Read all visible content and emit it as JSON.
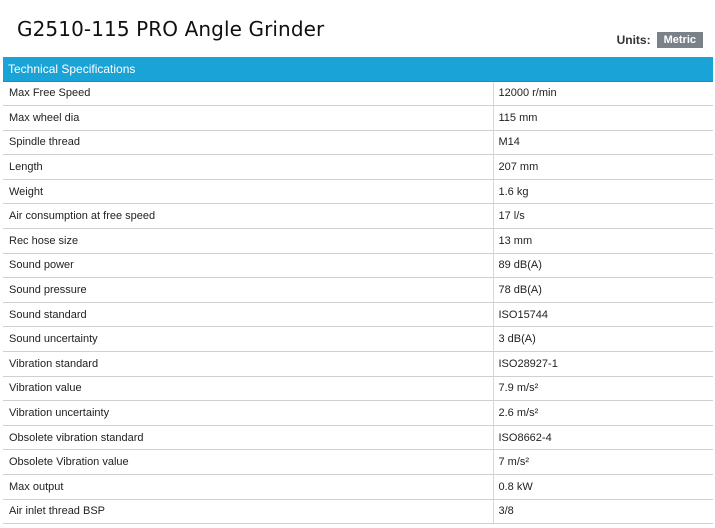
{
  "product": {
    "title": "G2510-115 PRO Angle Grinder"
  },
  "units": {
    "label": "Units:",
    "selected": "Metric"
  },
  "specs": {
    "header": "Technical Specifications",
    "rows": [
      {
        "name": "Max Free Speed",
        "value": "12000 r/min"
      },
      {
        "name": "Max wheel dia",
        "value": "115 mm"
      },
      {
        "name": "Spindle thread",
        "value": "M14"
      },
      {
        "name": "Length",
        "value": "207 mm"
      },
      {
        "name": "Weight",
        "value": "1.6 kg"
      },
      {
        "name": "Air consumption at free speed",
        "value": "17 l/s"
      },
      {
        "name": "Rec hose size",
        "value": "13 mm"
      },
      {
        "name": "Sound power",
        "value": "89 dB(A)"
      },
      {
        "name": "Sound pressure",
        "value": "78 dB(A)"
      },
      {
        "name": "Sound standard",
        "value": "ISO15744"
      },
      {
        "name": "Sound uncertainty",
        "value": "3 dB(A)"
      },
      {
        "name": "Vibration standard",
        "value": "ISO28927-1"
      },
      {
        "name": "Vibration value",
        "value": "7.9 m/s²"
      },
      {
        "name": "Vibration uncertainty",
        "value": "2.6 m/s²"
      },
      {
        "name": "Obsolete vibration standard",
        "value": "ISO8662-4"
      },
      {
        "name": "Obsolete Vibration value",
        "value": "7 m/s²"
      },
      {
        "name": "Max output",
        "value": "0.8 kW"
      },
      {
        "name": "Air inlet thread BSP",
        "value": "3/8"
      }
    ]
  },
  "colors": {
    "header_bg": "#1aa3d6",
    "units_toggle_bg": "#7b8189"
  }
}
